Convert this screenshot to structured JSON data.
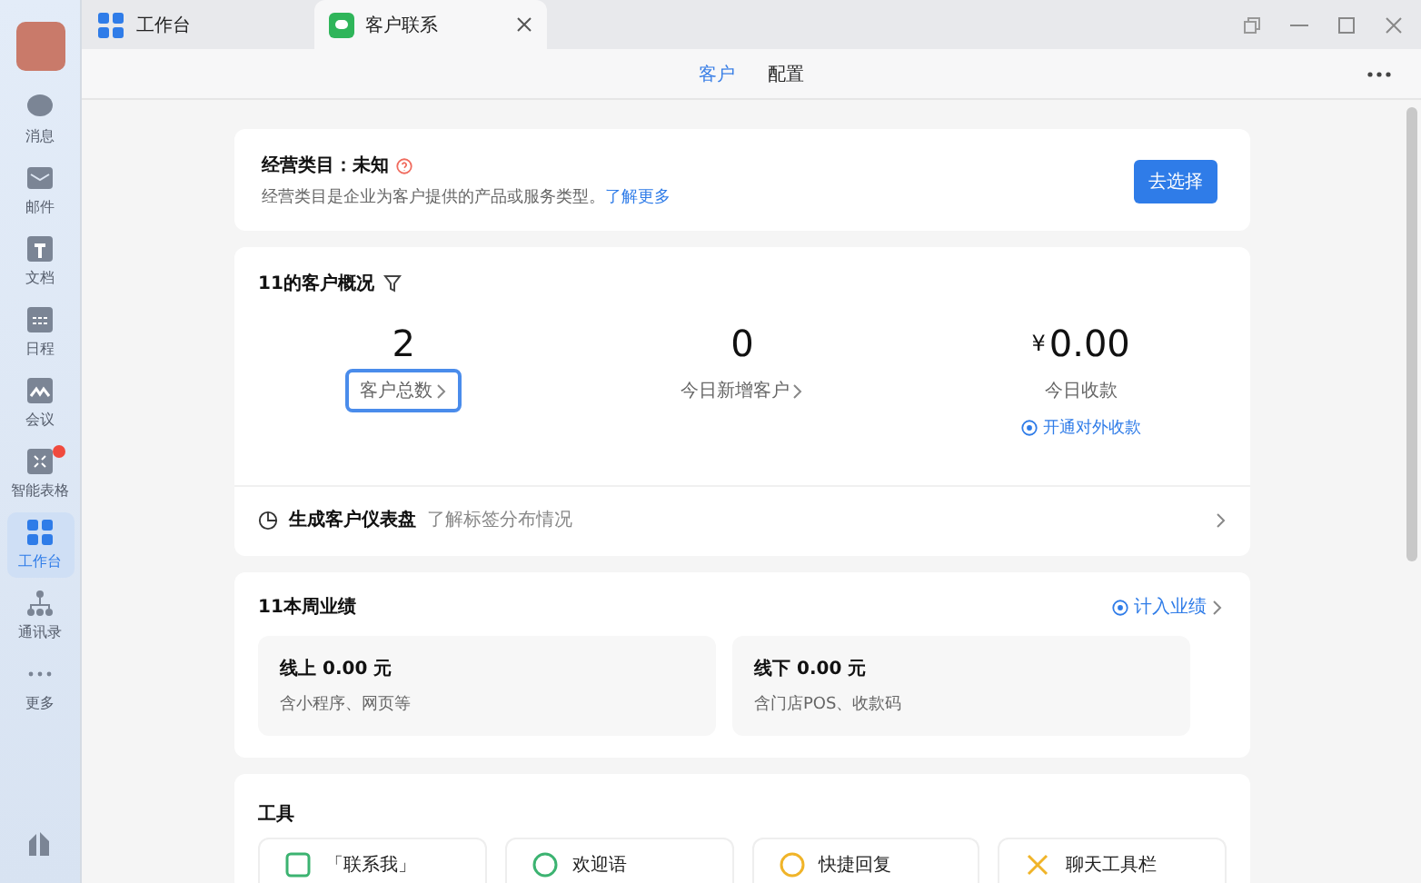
{
  "sidebar": {
    "items": [
      {
        "label": "消息",
        "kind": "chat",
        "selected": false,
        "badge": false
      },
      {
        "label": "邮件",
        "kind": "mail",
        "selected": false,
        "badge": false
      },
      {
        "label": "文档",
        "kind": "doc",
        "selected": false,
        "badge": false
      },
      {
        "label": "日程",
        "kind": "calendar",
        "selected": false,
        "badge": false
      },
      {
        "label": "会议",
        "kind": "meeting",
        "selected": false,
        "badge": false
      },
      {
        "label": "智能表格",
        "kind": "sheet",
        "selected": false,
        "badge": true
      },
      {
        "label": "工作台",
        "kind": "grid",
        "selected": true,
        "badge": false
      },
      {
        "label": "通讯录",
        "kind": "contacts",
        "selected": false,
        "badge": false
      },
      {
        "label": "更多",
        "kind": "more",
        "selected": false,
        "badge": false
      }
    ]
  },
  "tabs": [
    {
      "label": "工作台",
      "kind": "grid",
      "selected": false
    },
    {
      "label": "客户联系",
      "kind": "chat",
      "selected": true
    }
  ],
  "nav": [
    {
      "label": "客户",
      "selected": true
    },
    {
      "label": "配置",
      "selected": false
    }
  ],
  "category": {
    "title": "经营类目：未知",
    "description": "经营类目是企业为客户提供的产品或服务类型。",
    "link": "了解更多",
    "button": "去选择"
  },
  "overview": {
    "title": "11的客户概况",
    "stats": [
      {
        "value": "2",
        "label": "客户总数",
        "focused": true,
        "arrow": true
      },
      {
        "value": "0",
        "label": "今日新增客户",
        "focused": false,
        "arrow": true
      },
      {
        "currency": "¥",
        "value": "0.00",
        "label": "今日收款",
        "focused": false,
        "arrow": false,
        "link": "开通对外收款"
      }
    ],
    "dashboard": {
      "title": "生成客户仪表盘",
      "subtitle": "了解标签分布情况"
    }
  },
  "performance": {
    "title": "11本周业绩",
    "link": "计入业绩",
    "items": [
      {
        "label": "线上",
        "amount": "0.00",
        "unit": "元",
        "note": "含小程序、网页等"
      },
      {
        "label": "线下",
        "amount": "0.00",
        "unit": "元",
        "note": "含门店POS、收款码"
      }
    ]
  },
  "tools": {
    "title": "工具",
    "items": [
      {
        "label": "「联系我」",
        "kind": "contact",
        "color": "#3cb371"
      },
      {
        "label": "欢迎语",
        "kind": "welcome",
        "color": "#3cb371"
      },
      {
        "label": "快捷回复",
        "kind": "reply",
        "color": "#f0b429"
      },
      {
        "label": "聊天工具栏",
        "kind": "toolbar",
        "color": "#f0b429"
      }
    ]
  }
}
